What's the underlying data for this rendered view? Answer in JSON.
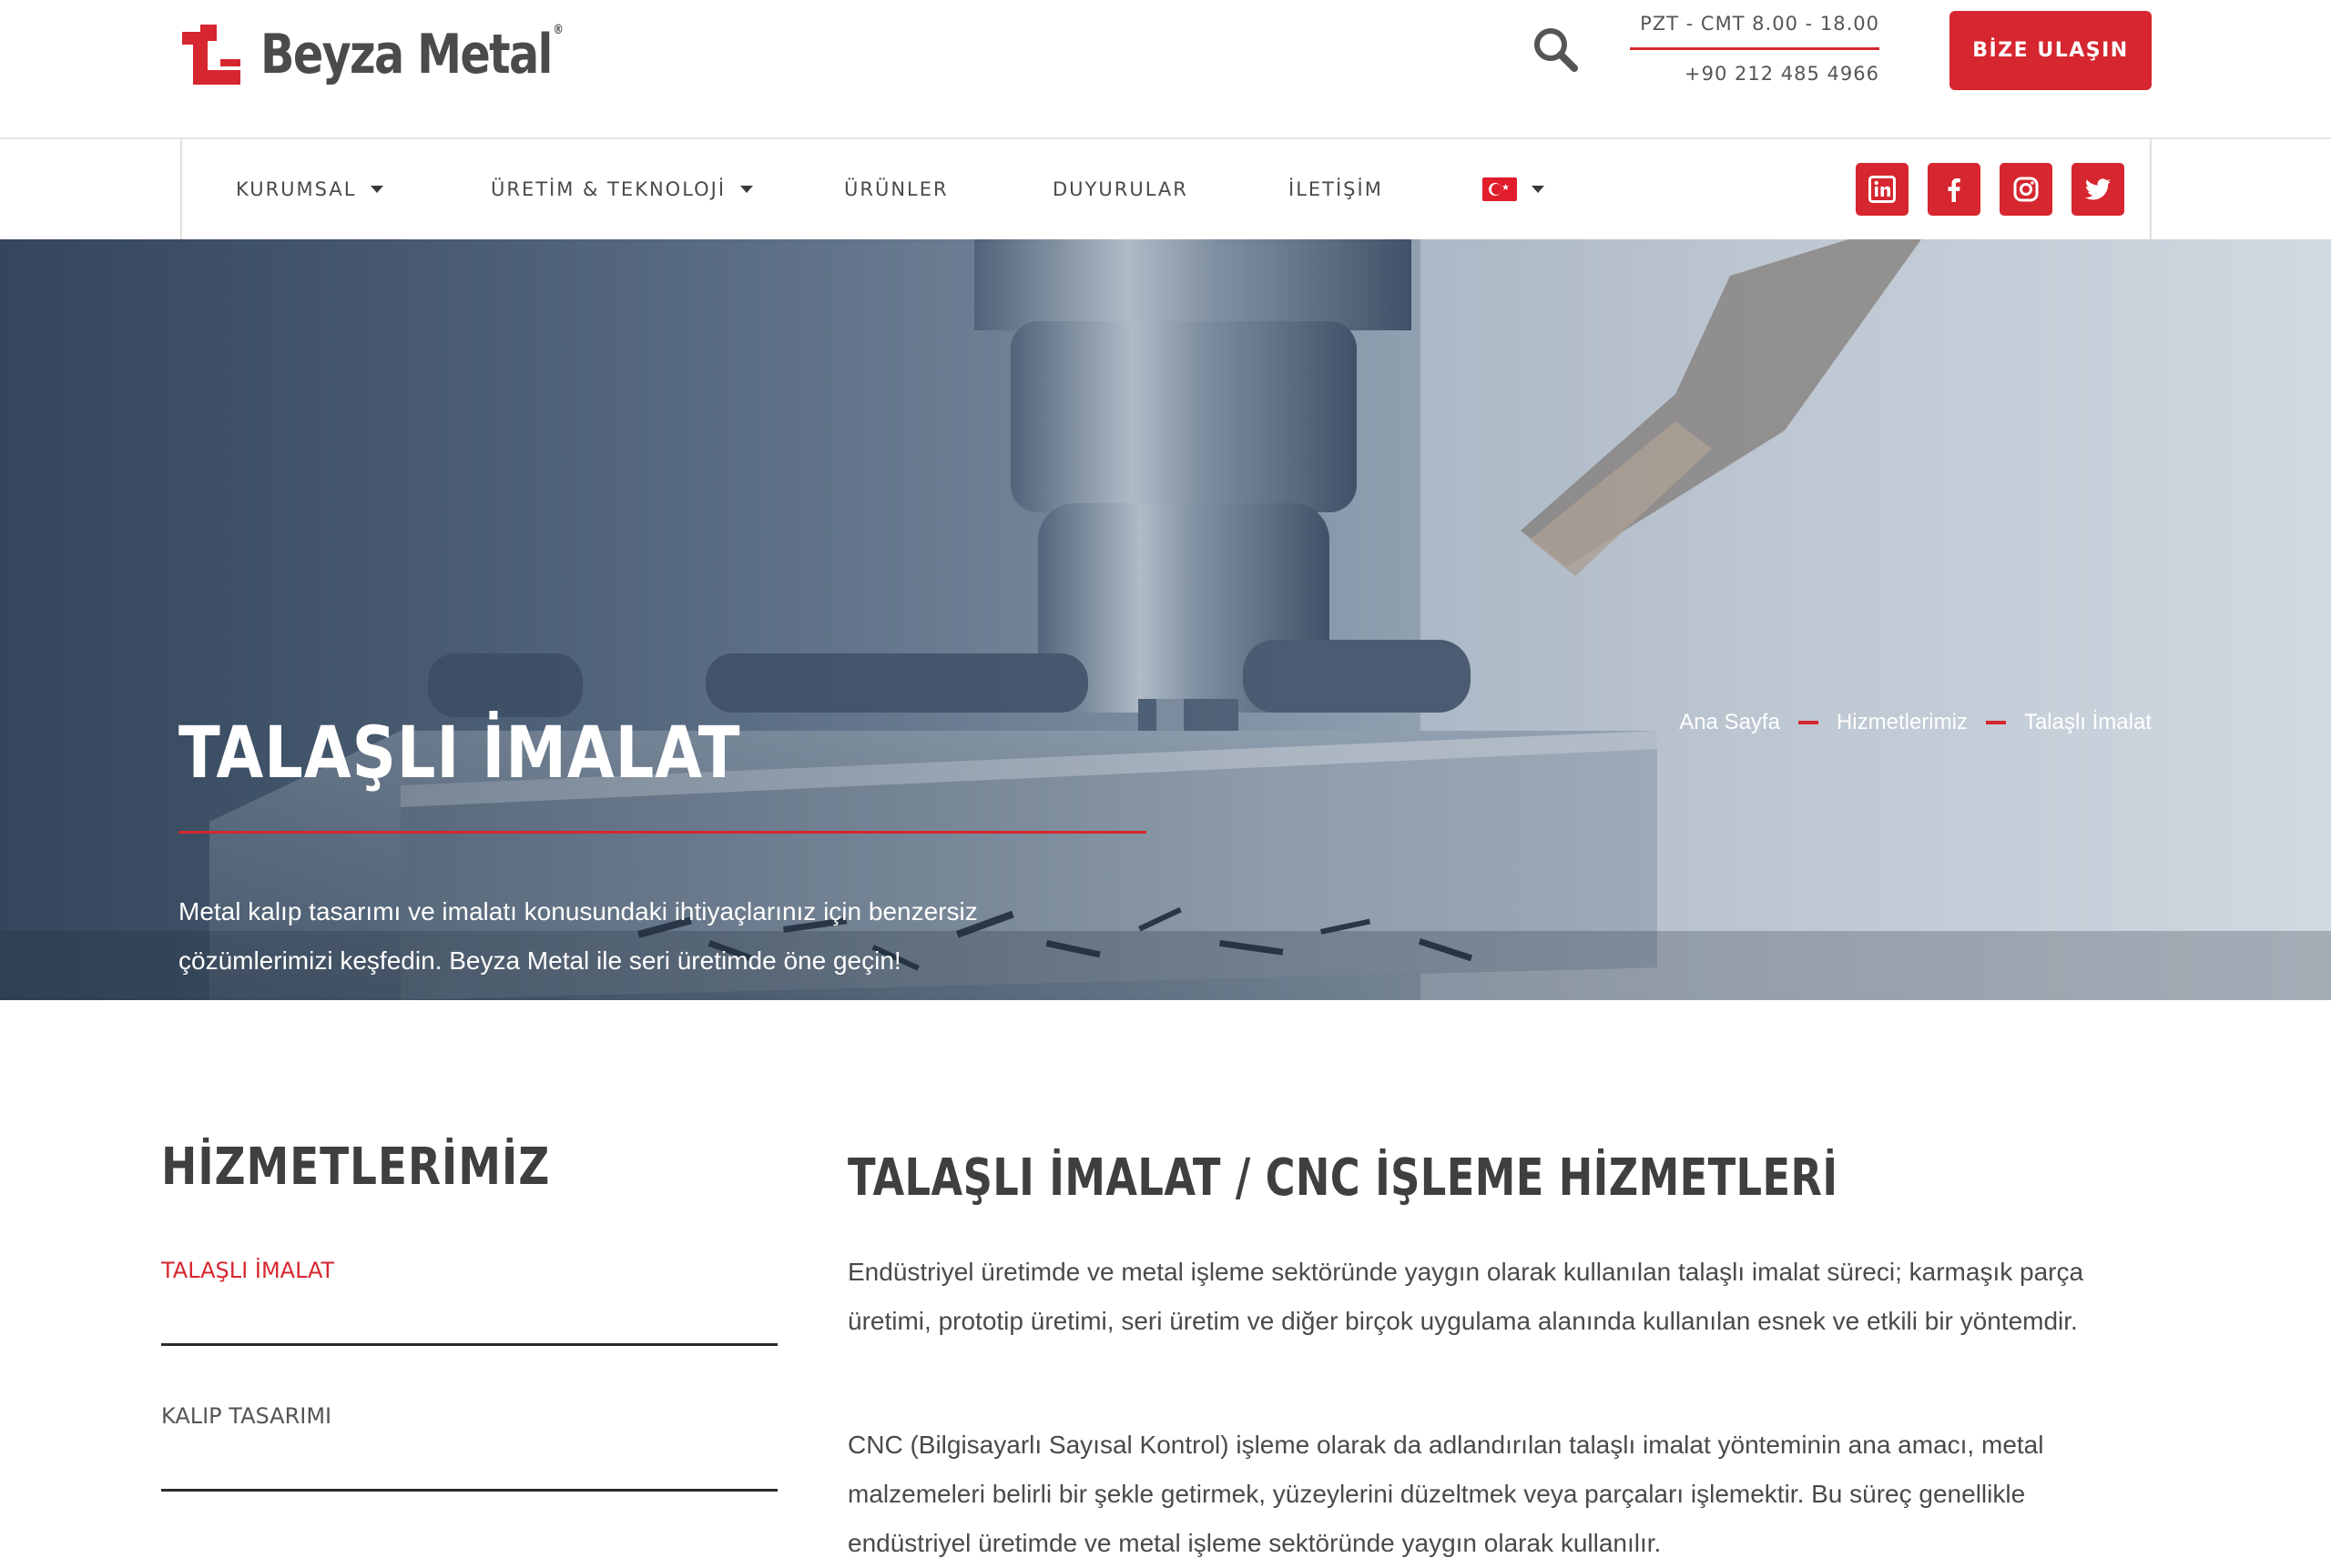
{
  "brand": {
    "name": "Beyza Metal",
    "registered": "®",
    "accent": "#d6262f"
  },
  "header": {
    "hours": "PZT - CMT 8.00 - 18.00",
    "phone": "+90 212 485 4966",
    "cta_label": "BİZE ULAŞIN"
  },
  "nav": {
    "items": [
      "KURUMSAL",
      "ÜRETİM & TEKNOLOJİ",
      "ÜRÜNLER",
      "DUYURULAR",
      "İLETİŞİM"
    ],
    "language": "Turkish flag"
  },
  "social": [
    "linkedin-icon",
    "facebook-icon",
    "instagram-icon",
    "twitter-icon"
  ],
  "hero": {
    "title": "TALAŞLI İMALAT",
    "text": "Metal kalıp tasarımı ve imalatı konusundaki ihtiyaçlarınız için benzersiz çözümlerimizi keşfedin. Beyza Metal ile seri üretimde öne geçin!",
    "breadcrumb": [
      "Ana Sayfa",
      "Hizmetlerimiz",
      "Talaşlı İmalat"
    ]
  },
  "sidebar": {
    "title": "HİZMETLERİMİZ",
    "items": [
      "TALAŞLI İMALAT",
      "KALIP TASARIMI"
    ]
  },
  "main": {
    "title": "TALAŞLI İMALAT / CNC İŞLEME HİZMETLERİ",
    "paragraphs": [
      "Endüstriyel üretimde ve metal işleme sektöründe yaygın olarak kullanılan talaşlı imalat süreci; karmaşık parça üretimi, prototip üretimi, seri üretim ve diğer birçok uygulama alanında kullanılan esnek ve etkili bir yöntemdir.",
      "CNC (Bilgisayarlı Sayısal Kontrol) işleme olarak da adlandırılan talaşlı imalat yönteminin ana amacı, metal malzemeleri belirli bir şekle getirmek, yüzeylerini düzeltmek veya parçaları işlemektir. Bu süreç genellikle endüstriyel üretimde ve metal işleme sektöründe yaygın olarak kullanılır."
    ]
  }
}
